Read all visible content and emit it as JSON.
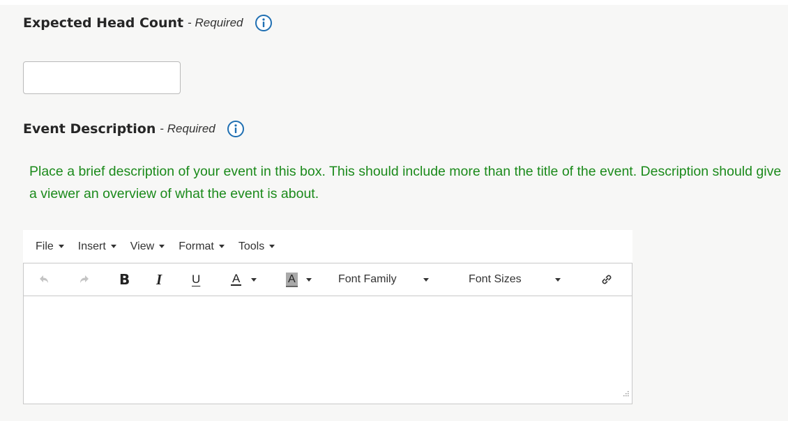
{
  "head_count": {
    "label": "Expected Head Count",
    "required_prefix": " - ",
    "required_text": "Required",
    "value": "",
    "info_icon": "info-circle-icon"
  },
  "event_description": {
    "label": "Event Description",
    "required_prefix": " - ",
    "required_text": "Required",
    "info_icon": "info-circle-icon",
    "help_text": "Place a brief description of your event in this box. This should include more than the title of the event. Description should give a viewer an overview of what the event is about."
  },
  "editor": {
    "menu": [
      "File",
      "Insert",
      "View",
      "Format",
      "Tools"
    ],
    "toolbar": {
      "undo_icon": "undo-icon",
      "redo_icon": "redo-icon",
      "bold": "B",
      "italic": "I",
      "underline": "U",
      "text_color": "A",
      "background_color": "A",
      "font_family": "Font Family",
      "font_sizes": "Font Sizes",
      "link_icon": "link-icon"
    },
    "content": ""
  },
  "colors": {
    "help_text": "#1b8a1b",
    "info_icon": "#1f6fb2",
    "background": "#f7f7f6"
  }
}
